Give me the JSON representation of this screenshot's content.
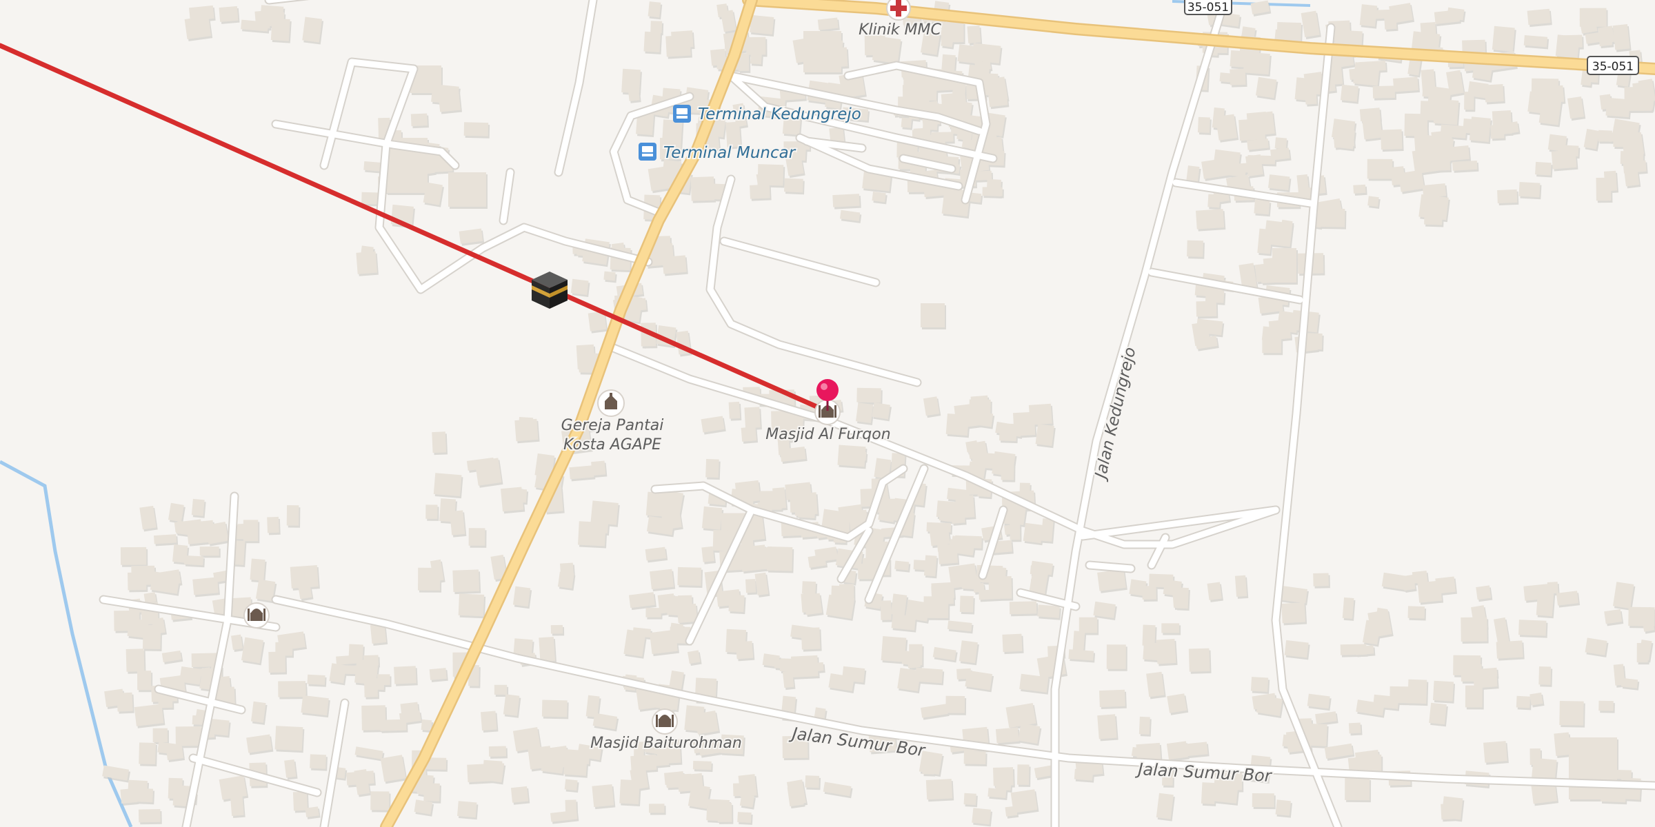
{
  "map": {
    "road_shields": [
      {
        "ref": "35-051"
      },
      {
        "ref": "35-051"
      }
    ],
    "pois": [
      {
        "name": "Klinik MMC",
        "icon": "clinic-cross-icon"
      },
      {
        "name": "Terminal Kedungrejo",
        "icon": "bus-icon"
      },
      {
        "name": "Terminal Muncar",
        "icon": "bus-icon"
      },
      {
        "name": "Gereja Pantai",
        "name2": "Kosta AGAPE",
        "icon": "church-icon"
      },
      {
        "name": "Masjid Al Furqon",
        "icon": "mosque-icon"
      },
      {
        "name": "Masjid Baiturohman",
        "icon": "mosque-icon"
      },
      {
        "name": "",
        "icon": "mosque-icon"
      }
    ],
    "streets": [
      {
        "name": "Jalan Kedungrejo"
      },
      {
        "name": "Jalan Sumur Bor"
      },
      {
        "name": "Jalan Sumur Bor"
      }
    ],
    "qibla_marker": {
      "icon": "kaaba-icon"
    },
    "location_pin": {
      "icon": "map-pin-icon"
    },
    "colors": {
      "background": "#f6f4f1",
      "minor_road": "#ffffff",
      "road_casing": "#d9d5cf",
      "major_road": "#fbdb96",
      "major_casing": "#e8c27a",
      "building": "#e8e2d9",
      "qibla_line": "#d62d2d",
      "river": "#9ec9ee",
      "pin": "#e8175d",
      "label": "#5d5d5d",
      "transit_label": "#2f6d96"
    }
  }
}
